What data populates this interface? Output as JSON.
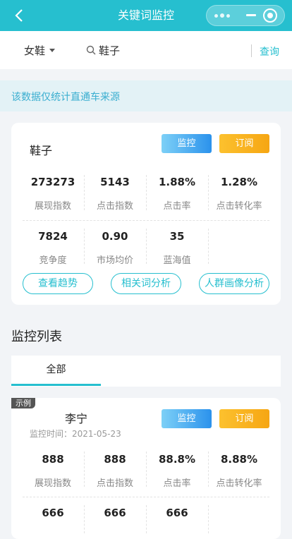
{
  "nav": {
    "title": "关键词监控",
    "accent": "#26bfcf"
  },
  "search": {
    "category": "女鞋",
    "keyword": "鞋子",
    "query_label": "查询"
  },
  "notice": "该数据仅统计直通车来源",
  "keyword_card": {
    "keyword": "鞋子",
    "monitor_label": "监控",
    "subscribe_label": "订阅",
    "row1": [
      {
        "value": "273273",
        "label": "展现指数"
      },
      {
        "value": "5143",
        "label": "点击指数"
      },
      {
        "value": "1.88%",
        "label": "点击率"
      },
      {
        "value": "1.28%",
        "label": "点击转化率"
      }
    ],
    "row2": [
      {
        "value": "7824",
        "label": "竞争度"
      },
      {
        "value": "0.90",
        "label": "市场均价"
      },
      {
        "value": "35",
        "label": "蓝海值"
      }
    ],
    "actions": [
      "查看趋势",
      "相关词分析",
      "人群画像分析"
    ]
  },
  "monitor_list": {
    "title": "监控列表",
    "tab_all": "全部",
    "item": {
      "badge": "示例",
      "brand": "李宁",
      "monitor_time": "监控时间：2021-05-23",
      "monitor_label": "监控",
      "subscribe_label": "订阅",
      "row1": [
        {
          "value": "888",
          "label": "展现指数"
        },
        {
          "value": "888",
          "label": "点击指数"
        },
        {
          "value": "88.8%",
          "label": "点击率"
        },
        {
          "value": "8.88%",
          "label": "点击转化率"
        }
      ],
      "row2": [
        {
          "value": "666"
        },
        {
          "value": "666"
        },
        {
          "value": "666"
        }
      ]
    }
  }
}
